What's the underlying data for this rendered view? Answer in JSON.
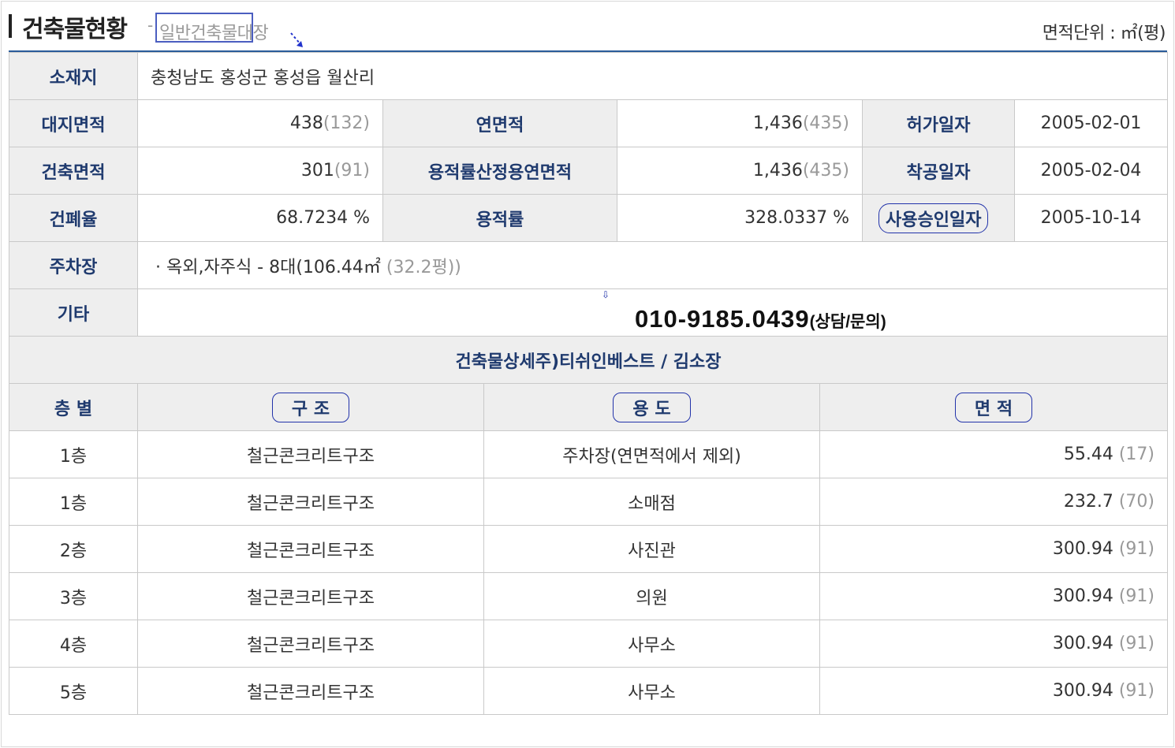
{
  "header": {
    "title": "건축물현황",
    "dash": "-",
    "subtitle": "일반건축물대장",
    "unit_label": "면적단위 : ㎡(평)"
  },
  "summary": {
    "location_label": "소재지",
    "location_value": "충청남도 홍성군 홍성읍 월산리",
    "site_area_label": "대지면적",
    "site_area_value": "438",
    "site_area_pyeong": "(132)",
    "total_floor_area_label": "연면적",
    "total_floor_area_value": "1,436",
    "total_floor_area_pyeong": "(435)",
    "permit_date_label": "허가일자",
    "permit_date_value": "2005-02-01",
    "building_area_label": "건축면적",
    "building_area_value": "301",
    "building_area_pyeong": "(91)",
    "far_floor_area_label": "용적률산정용연면적",
    "far_floor_area_value": "1,436",
    "far_floor_area_pyeong": "(435)",
    "construction_start_label": "착공일자",
    "construction_start_value": "2005-02-04",
    "coverage_ratio_label": "건폐율",
    "coverage_ratio_value": "68.7234 %",
    "floor_area_ratio_label": "용적률",
    "floor_area_ratio_value": "328.0337 %",
    "approval_date_label": "사용승인일자",
    "approval_date_value": "2005-10-14",
    "parking_label": "주차장",
    "parking_value": "· 옥외,자주식 - 8대(106.44㎡",
    "parking_pyeong": "(32.2평))",
    "other_label": "기타",
    "phone": "010-9185.0439",
    "phone_suffix": "(상담/문의)"
  },
  "detail": {
    "section_title": "건축물상세주)티쉬인베스트 / 김소장",
    "columns": [
      "층 별",
      "구 조",
      "용 도",
      "면 적"
    ],
    "rows": [
      {
        "floor": "1층",
        "structure": "철근콘크리트구조",
        "use": "주차장(연면적에서 제외)",
        "area": "55.44",
        "pyeong": "(17)"
      },
      {
        "floor": "1층",
        "structure": "철근콘크리트구조",
        "use": "소매점",
        "area": "232.7",
        "pyeong": "(70)"
      },
      {
        "floor": "2층",
        "structure": "철근콘크리트구조",
        "use": "사진관",
        "area": "300.94",
        "pyeong": "(91)"
      },
      {
        "floor": "3층",
        "structure": "철근콘크리트구조",
        "use": "의원",
        "area": "300.94",
        "pyeong": "(91)"
      },
      {
        "floor": "4층",
        "structure": "철근콘크리트구조",
        "use": "사무소",
        "area": "300.94",
        "pyeong": "(91)"
      },
      {
        "floor": "5층",
        "structure": "철근콘크리트구조",
        "use": "사무소",
        "area": "300.94",
        "pyeong": "(91)"
      }
    ]
  }
}
